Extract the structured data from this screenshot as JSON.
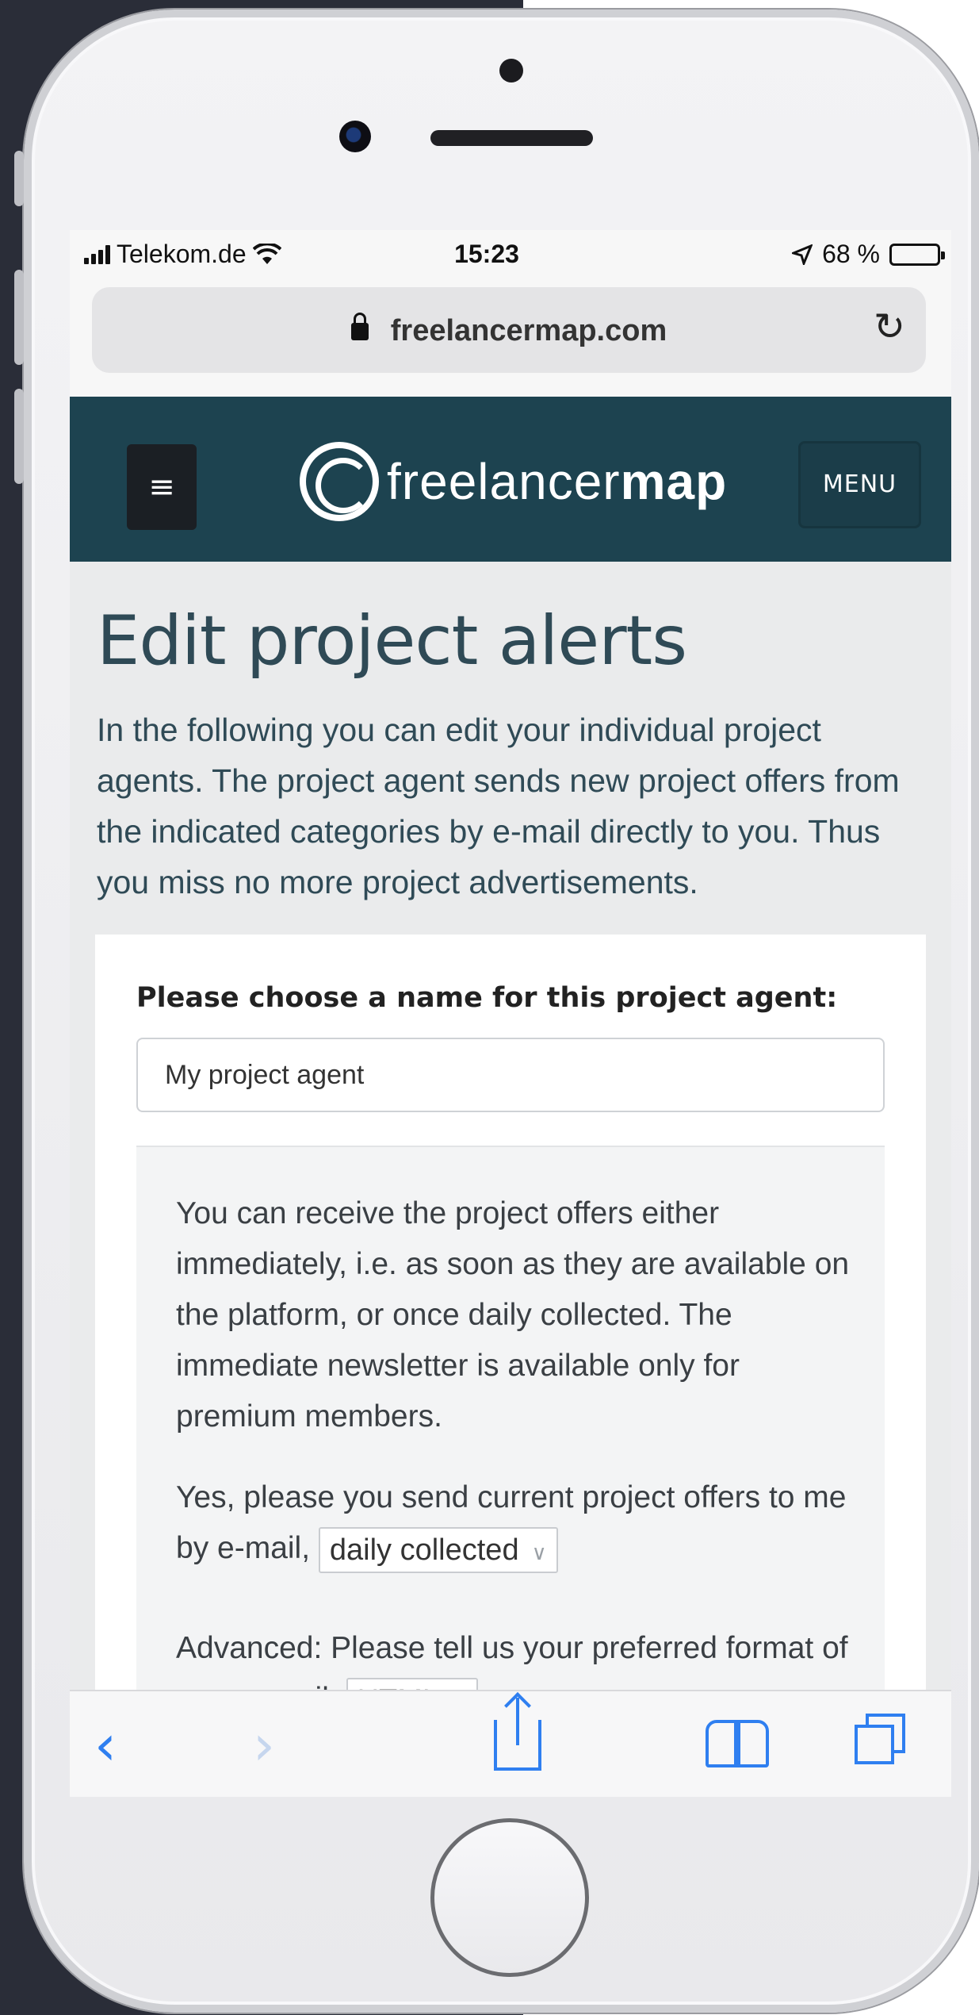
{
  "status_bar": {
    "carrier": "Telekom.de",
    "time": "15:23",
    "battery": "68 %",
    "battery_level": 0.68
  },
  "browser": {
    "url": "freelancermap.com"
  },
  "site_header": {
    "hamburger_label": "≡",
    "logo_text_light": "freelancer",
    "logo_text_bold": "map",
    "menu_label": "MENU"
  },
  "page": {
    "title": "Edit project alerts",
    "intro": "In the following you can edit your individual project agents. The project agent sends new project offers from the indicated categories by e-mail directly to you. Thus you miss no more project advertisements."
  },
  "form": {
    "name_label": "Please choose a name for this project agent:",
    "name_value": "My project agent",
    "info_text": "You can receive the project offers either immediately, i.e. as soon as they are available on the platform, or once daily collected. The immediate newsletter is available only for premium members.",
    "frequency_prefix": "Yes, please you send current project offers to me by e-mail,",
    "frequency_value": "daily collected",
    "format_prefix": "Advanced: Please tell us your preferred format of your e-mail:",
    "format_value": "HTML"
  },
  "toolbar": {
    "back_icon": "‹",
    "forward_icon": "›"
  }
}
